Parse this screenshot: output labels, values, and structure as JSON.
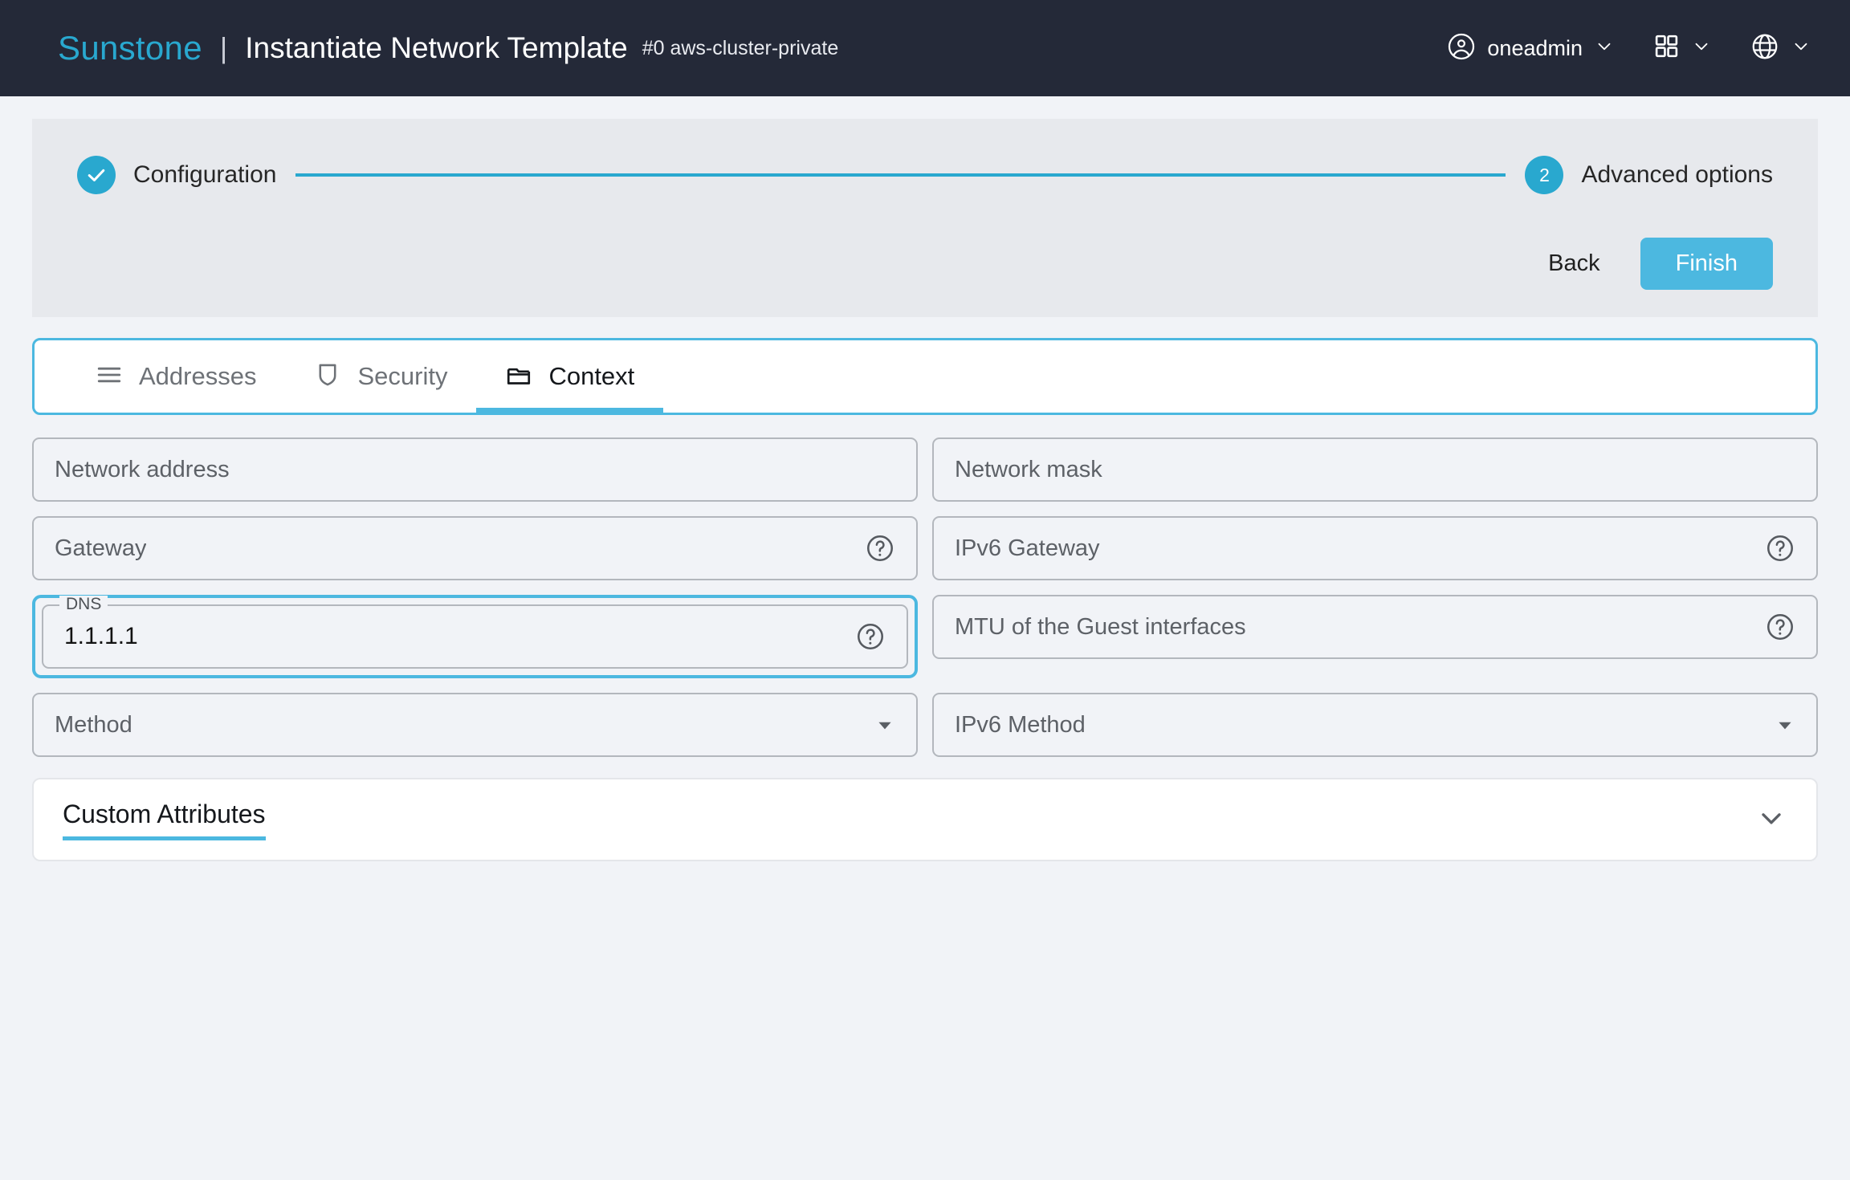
{
  "header": {
    "brand": "Sunstone",
    "separator": "|",
    "title": "Instantiate Network Template",
    "subtitle": "#0 aws-cluster-private",
    "user": {
      "name": "oneadmin",
      "icon": "user-circle-icon",
      "chevron": "chevron-down-icon"
    },
    "apps": {
      "icon": "grid-apps-icon",
      "chevron": "chevron-down-icon"
    },
    "language": {
      "icon": "globe-icon",
      "chevron": "chevron-down-icon"
    }
  },
  "wizard": {
    "steps": [
      {
        "id": "configuration",
        "label": "Configuration",
        "marker": "✓",
        "state": "completed"
      },
      {
        "id": "advanced-options",
        "label": "Advanced options",
        "marker": "2",
        "state": "active"
      }
    ],
    "back_label": "Back",
    "finish_label": "Finish"
  },
  "tabs": [
    {
      "id": "addresses",
      "label": "Addresses",
      "icon": "list-lines-icon",
      "active": false
    },
    {
      "id": "security",
      "label": "Security",
      "icon": "shield-icon",
      "active": false
    },
    {
      "id": "context",
      "label": "Context",
      "icon": "folder-icon",
      "active": true
    }
  ],
  "form": {
    "rows": [
      {
        "left": {
          "id": "network-address",
          "placeholder": "Network address",
          "value": "",
          "type": "text",
          "help": false
        },
        "right": {
          "id": "network-mask",
          "placeholder": "Network mask",
          "value": "",
          "type": "text",
          "help": false
        }
      },
      {
        "left": {
          "id": "gateway",
          "placeholder": "Gateway",
          "value": "",
          "type": "text",
          "help": true
        },
        "right": {
          "id": "ipv6-gateway",
          "placeholder": "IPv6 Gateway",
          "value": "",
          "type": "text",
          "help": true
        }
      },
      {
        "left": {
          "id": "dns",
          "placeholder": "DNS",
          "legend": "DNS",
          "value": "1.1.1.1",
          "type": "text",
          "help": true,
          "focused": true
        },
        "right": {
          "id": "mtu",
          "placeholder": "MTU of the Guest interfaces",
          "value": "",
          "type": "text",
          "help": true
        }
      },
      {
        "left": {
          "id": "method",
          "placeholder": "Method",
          "value": "",
          "type": "select",
          "help": false
        },
        "right": {
          "id": "ipv6-method",
          "placeholder": "IPv6 Method",
          "value": "",
          "type": "select",
          "help": false
        }
      }
    ]
  },
  "custom_attributes": {
    "title": "Custom Attributes",
    "expanded": false,
    "chevron": "chevron-down-icon"
  },
  "colors": {
    "brand_accent": "#29a8cf",
    "button_primary": "#4cb8e0",
    "header_bg": "#242938",
    "page_bg": "#f1f3f7",
    "panel_bg": "#e7e9ed"
  }
}
